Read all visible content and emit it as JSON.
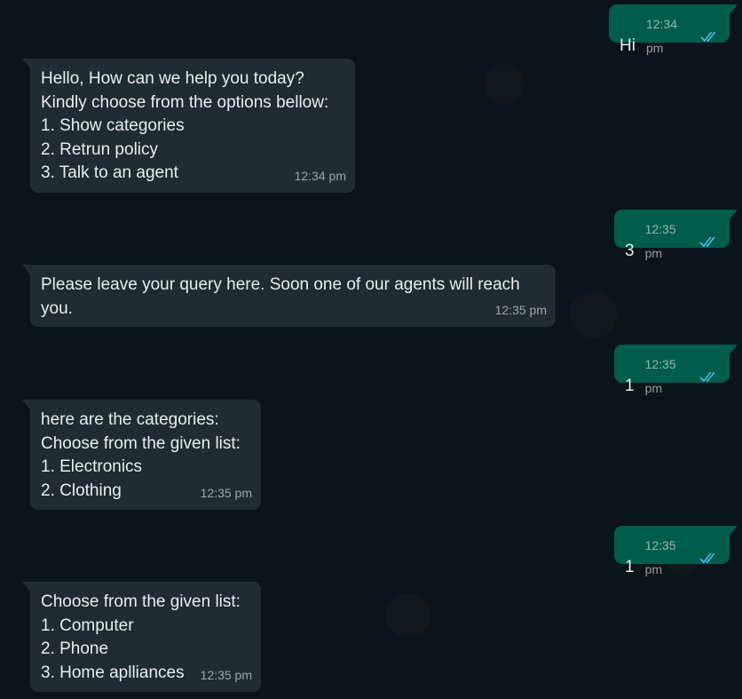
{
  "messages": [
    {
      "side": "outgoing",
      "lines": [
        "Hi"
      ],
      "time": "12:34 pm",
      "read_icon": "double-check-icon"
    },
    {
      "side": "incoming",
      "lines": [
        "Hello, How can we help you today?",
        "Kindly choose from the options bellow:",
        "1. Show categories",
        "2. Retrun policy",
        "3. Talk to an agent"
      ],
      "time": "12:34 pm"
    },
    {
      "side": "outgoing",
      "lines": [
        "3"
      ],
      "time": "12:35 pm",
      "read_icon": "double-check-icon"
    },
    {
      "side": "incoming",
      "lines": [
        "Please leave your query here. Soon one of our agents will reach",
        "you."
      ],
      "time": "12:35 pm"
    },
    {
      "side": "outgoing",
      "lines": [
        "1"
      ],
      "time": "12:35 pm",
      "read_icon": "double-check-icon"
    },
    {
      "side": "incoming",
      "lines": [
        "here are the categories:",
        "Choose from the given list:",
        "1. Electronics",
        "2. Clothing"
      ],
      "time": "12:35 pm"
    },
    {
      "side": "outgoing",
      "lines": [
        "1"
      ],
      "time": "12:35 pm",
      "read_icon": "double-check-icon"
    },
    {
      "side": "incoming",
      "lines": [
        "Choose from the given list:",
        "1. Computer",
        "2. Phone",
        "3. Home aplliances"
      ],
      "time": "12:35 pm"
    }
  ],
  "colors": {
    "background": "#0b141a",
    "incoming_bubble": "#202c33",
    "outgoing_bubble": "#005c4b",
    "text": "#e9edef",
    "read_tick": "#53bdeb"
  }
}
